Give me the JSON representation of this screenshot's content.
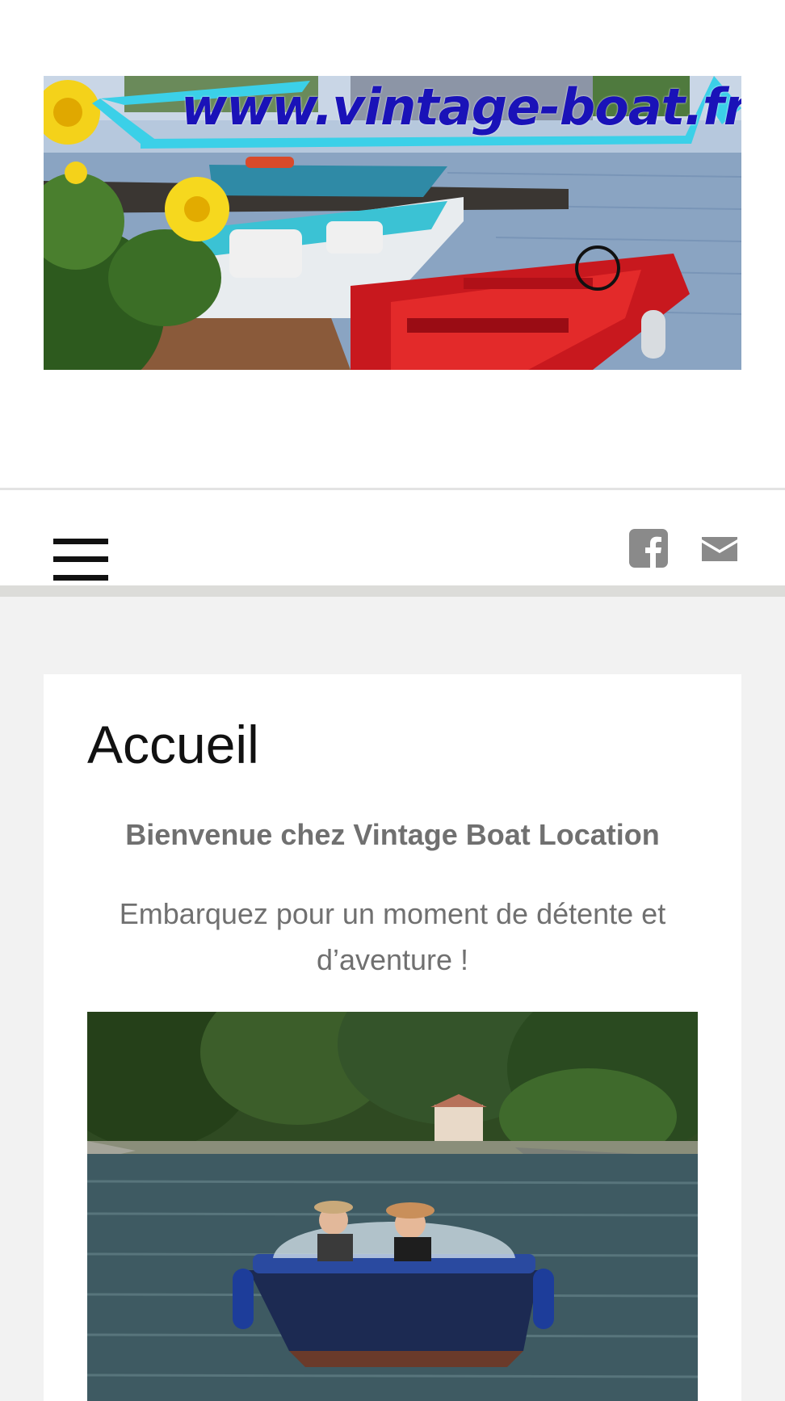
{
  "header": {
    "banner_url_text": "www.vintage-boat.fr",
    "banner_image": "vintage-boats-dock-banner"
  },
  "navbar": {
    "menu_icon": "hamburger-menu-icon",
    "social": [
      {
        "icon": "facebook-icon"
      },
      {
        "icon": "mail-icon"
      }
    ]
  },
  "main": {
    "page_title": "Accueil",
    "welcome": "Bienvenue chez Vintage Boat Location",
    "tagline": "Embarquez pour un moment de détente et d’aventure !",
    "hero_image": "couple-in-vintage-boat-on-canal"
  },
  "colors": {
    "page_bg": "#f2f2f2",
    "card_bg": "#ffffff",
    "text_dark": "#111111",
    "text_grey": "#707070",
    "icon_grey": "#8a8a8a",
    "banner_url": "#1a12b8",
    "banner_cyan": "#3bd0e8"
  }
}
